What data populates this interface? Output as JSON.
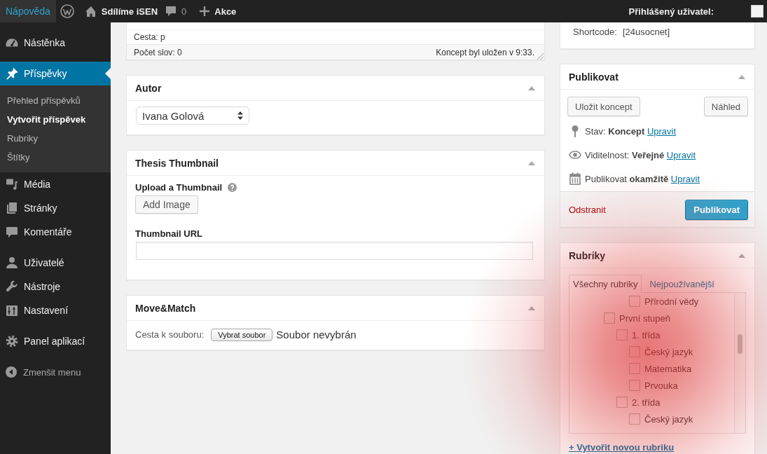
{
  "admin_bar": {
    "help": "Nápověda",
    "site_name": "Sdílíme iSEN",
    "comments_count": "0",
    "new_content": "Akce",
    "account": "Přihlášený uživatel:"
  },
  "sidebar": {
    "groups": [
      {
        "items": [
          {
            "label": "Nástěnka",
            "selected": false
          }
        ]
      },
      {
        "items": [
          {
            "label": "Příspěvky",
            "selected": true,
            "submenu": [
              {
                "label": "Přehled příspěvků",
                "selected": false
              },
              {
                "label": "Vytvořit příspěvek",
                "selected": true
              },
              {
                "label": "Rubriky",
                "selected": false
              },
              {
                "label": "Štítky",
                "selected": false
              }
            ]
          },
          {
            "label": "Média",
            "selected": false
          },
          {
            "label": "Stránky",
            "selected": false
          },
          {
            "label": "Komentáře",
            "selected": false
          }
        ]
      },
      {
        "items": [
          {
            "label": "Uživatelé",
            "selected": false
          },
          {
            "label": "Nástroje",
            "selected": false
          },
          {
            "label": "Nastavení",
            "selected": false
          }
        ]
      },
      {
        "items": [
          {
            "label": "Panel aplikací",
            "selected": false
          }
        ]
      }
    ],
    "collapse": "Zmenšit menu"
  },
  "editor": {
    "path": "Cesta: p",
    "word_count": "Počet slov: 0",
    "autosave": "Koncept byl uložen v 9:33."
  },
  "author_box": {
    "title": "Autor",
    "expanded": true,
    "author": "Ivana Golová"
  },
  "thumbnail_box": {
    "title": "Thesis Thumbnail",
    "expanded": true,
    "upload_label": "Upload a Thumbnail",
    "add_button": "Add Image",
    "url_label": "Thumbnail URL"
  },
  "move_match_box": {
    "title": "Move&Match",
    "expanded": true,
    "file_label": "Cesta k souboru:",
    "file_button": "Vybrat soubor",
    "file_status": "Soubor nevybrán"
  },
  "shortcode_box": {
    "label": "Shortcode:",
    "value": "[24usocnet]"
  },
  "publish_box": {
    "title": "Publikovat",
    "expanded": true,
    "save_draft": "Uložit koncept",
    "preview": "Náhled",
    "rows": [
      {
        "text": "Stav: **Koncept**",
        "link": "Upravit"
      },
      {
        "text": "Viditelnost: **Veřejné**",
        "link": "Upravit"
      },
      {
        "text": "Publikovat **okamžitě**",
        "link": "Upravit"
      }
    ],
    "delete": "Odstranit",
    "publish": "Publikovat"
  },
  "categories_box": {
    "title": "Rubriky",
    "expanded": true,
    "tabs": [
      {
        "label": "Všechny rubriky",
        "selected": true
      },
      {
        "label": "Nejpoužívanější",
        "selected": false
      }
    ],
    "tree": [
      {
        "children": [
          {
            "children": [
              {
                "children": [
                  {
                    "label": "Přírodní vědy",
                    "checked": false
                  }
                ]
              }
            ]
          },
          {
            "label": "První stupeň",
            "checked": false,
            "children": [
              {
                "label": "1. třída",
                "checked": false,
                "children": [
                  {
                    "label": "Český jazyk",
                    "checked": false
                  },
                  {
                    "label": "Matematika",
                    "checked": false
                  },
                  {
                    "label": "Prvouka",
                    "checked": false
                  }
                ]
              },
              {
                "label": "2. třída",
                "checked": false,
                "children": [
                  {
                    "label": "Český jazyk",
                    "checked": false
                  }
                ]
              }
            ]
          }
        ]
      }
    ],
    "add_link": "+ Vytvořit novou rubriku"
  }
}
